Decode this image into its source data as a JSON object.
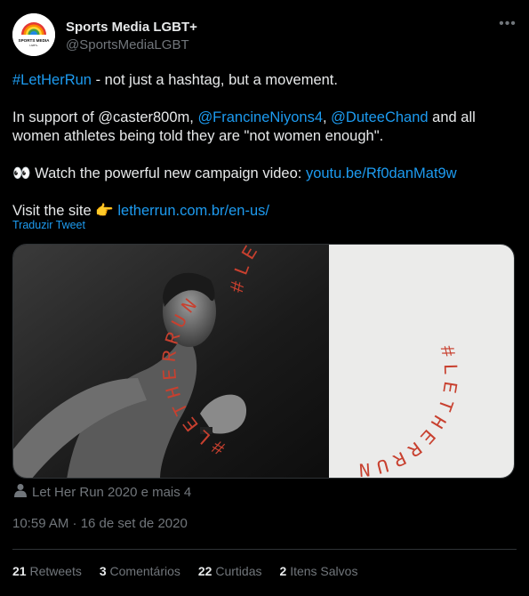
{
  "author": {
    "name": "Sports Media LGBT+",
    "handle": "@SportsMediaLGBT",
    "avatar_text": "SPORTS MEDIA",
    "avatar_subtext": "LGBT+"
  },
  "tweet": {
    "line1_hashtag": "#LetHerRun",
    "line1_rest": " - not just a hashtag, but a movement.",
    "line2_a": "In support of @caster800m, ",
    "line2_m1": "@FrancineNiyons4",
    "line2_sep": ", ",
    "line2_m2": "@DuteeChand",
    "line2_b": " and all",
    "line3": "women athletes being told they are \"not women enough\".",
    "line4_text": "👀 Watch the powerful new campaign video:  ",
    "line4_link": "youtu.be/Rf0danMat9w",
    "line5_text": "Visit the site 👉 ",
    "line5_link": "letherrun.com.br/en-us/",
    "translate": "Traduzir Tweet"
  },
  "media": {
    "arc_text_right": "#LETHERRUN",
    "arc_text_left": "#LETHERRUN",
    "caption": "Let Her Run 2020 e mais 4"
  },
  "meta": {
    "timestamp": "10:59 AM · 16 de set de 2020"
  },
  "stats": [
    {
      "num": "21",
      "label": "Retweets"
    },
    {
      "num": "3",
      "label": "Comentários"
    },
    {
      "num": "22",
      "label": "Curtidas"
    },
    {
      "num": "2",
      "label": "Itens Salvos"
    }
  ],
  "colors": {
    "link": "#1d9bf0",
    "accent_red": "#c8402f",
    "muted": "#71767b"
  },
  "icons": {
    "more": "more-icon",
    "person": "person-icon"
  }
}
